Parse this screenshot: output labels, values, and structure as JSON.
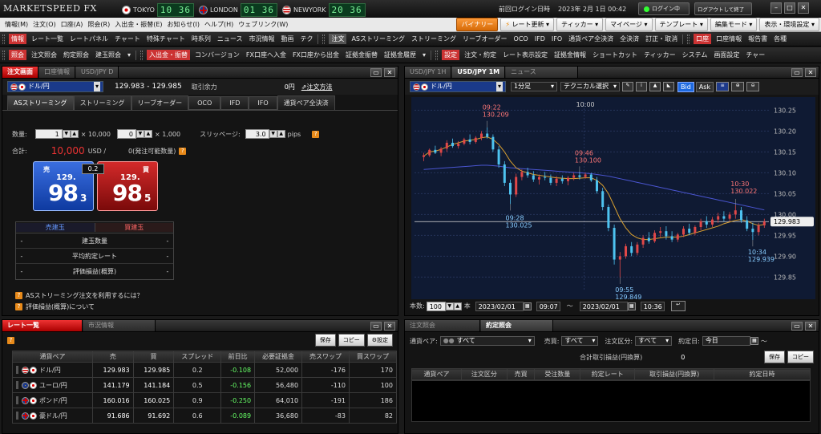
{
  "titlebar": {
    "logo": "MARKETSPEED FX",
    "cities": [
      {
        "name": "TOKYO",
        "time": "10 36",
        "flag": "jp"
      },
      {
        "name": "LONDON",
        "time": "01 36",
        "flag": "uk"
      },
      {
        "name": "NEWYORK",
        "time": "20 36",
        "flag": "us"
      }
    ],
    "last_login_label": "前回ログイン日時",
    "last_login_value": "2023年 2月 1日 00:42",
    "login_status": "ログイン中",
    "logout_btn": "ログアウトして終了"
  },
  "menubar": {
    "items": [
      "情報(M)",
      "注文(O)",
      "口座(A)",
      "照会(R)",
      "入出金・振替(E)",
      "お知らせ(I)",
      "ヘルプ(H)",
      "ウェブリンク(W)"
    ],
    "binary": "バイナリー",
    "rate_update": "レート更新",
    "ticker": "ティッカー",
    "mypage": "マイページ",
    "template": "テンプレート",
    "edit_mode": "編集モード",
    "display_settings": "表示・環境設定"
  },
  "toolbar1": {
    "tag1": "情報",
    "items1": [
      "レート一覧",
      "レートパネル",
      "チャート",
      "特殊チャート",
      "時系列",
      "ニュース",
      "市況情報",
      "動画",
      "テク"
    ],
    "tag2": "注文",
    "items2": [
      "ASストリーミング",
      "ストリーミング",
      "リーブオーダー",
      "OCO",
      "IFD",
      "IFO",
      "通貨ペア全決済",
      "全決済",
      "訂正・取消"
    ],
    "tag3": "口座",
    "items3": [
      "口座情報",
      "報告書",
      "各種"
    ]
  },
  "toolbar2": {
    "tag1": "照会",
    "items1": [
      "注文照会",
      "約定照会",
      "建玉照会"
    ],
    "tag2": "入出金・振替",
    "items2": [
      "コンバージョン",
      "FX口座へ入金",
      "FX口座から出金",
      "証拠金振替",
      "証拠金履歴"
    ],
    "tag3": "設定",
    "items3": [
      "注文・約定",
      "レート表示設定",
      "証拠金情報",
      "ショートカット",
      "ティッカー",
      "システム",
      "画面設定",
      "チャー"
    ]
  },
  "order_panel": {
    "tabs": [
      "注文画面",
      "口座情報",
      "USD/JPY D"
    ],
    "pair": "ドル/円",
    "bid": "129.983",
    "dash": "-",
    "ask": "129.985",
    "margin_label": "取引余力",
    "margin_value": "0円",
    "howto": "注文方法",
    "subtabs": [
      "ASストリーミング",
      "ストリーミング",
      "リーブオーダー",
      "OCO",
      "IFD",
      "IFO",
      "通貨ペア全決済"
    ],
    "qty_label": "数量:",
    "qty1": "1",
    "qty1_unit": "× 10,000",
    "qty2": "0",
    "qty2_unit": "× 1,000",
    "slip_label": "スリッページ:",
    "slip_value": "3.0",
    "slip_unit": "pips",
    "total_label": "合計:",
    "total_value": "10,000",
    "total_unit": "USD /",
    "available": "0(発注可能数量)",
    "sell_label": "売",
    "sell_big": "129.",
    "sell_main": "98",
    "sell_small": "3",
    "spread": "0.2",
    "buy_label": "買",
    "buy_big": "129.",
    "buy_main": "98",
    "buy_small": "5",
    "pos_sell": "売建玉",
    "pos_buy": "買建玉",
    "pos_rows": [
      {
        "label": "建玉数量",
        "left": "-",
        "right": "-"
      },
      {
        "label": "平均約定レート",
        "left": "-",
        "right": "-"
      },
      {
        "label": "評価損益(概算)",
        "left": "-",
        "right": "-"
      }
    ],
    "help1": "ASストリーミング注文を利用するには？",
    "help2": "評価損益(概算)について"
  },
  "chart_panel": {
    "tabs": [
      "USD/JPY 1H",
      "USD/JPY 1M",
      "ニュース"
    ],
    "pair": "ドル/円",
    "period": "1分足",
    "tech": "テクニカル選択",
    "bid_btn": "Bid",
    "ask_btn": "Ask",
    "count_label": "本数:",
    "count_value": "100",
    "count_unit": "本",
    "from_date": "2023/02/01",
    "from_time": "09:07",
    "tilde": "～",
    "to_date": "2023/02/01",
    "to_time": "10:36"
  },
  "chart_data": {
    "type": "candlestick",
    "ylim": [
      129.82,
      130.27
    ],
    "yticks": [
      "130.25",
      "130.20",
      "130.15",
      "130.10",
      "130.05",
      "130.00",
      "129.95",
      "129.90",
      "129.85"
    ],
    "current_price": "129.983",
    "time_marker": "10:00",
    "annotations": [
      {
        "time": "09:22",
        "price": "130.209"
      },
      {
        "time": "09:46",
        "price": "130.100"
      },
      {
        "time": "09:28",
        "price": "130.025"
      },
      {
        "time": "09:55",
        "price": "129.849"
      },
      {
        "time": "10:30",
        "price": "130.022"
      },
      {
        "time": "10:34",
        "price": "129.939"
      }
    ],
    "candles": [
      [
        130.138,
        130.148,
        130.128,
        130.142
      ],
      [
        130.142,
        130.158,
        130.138,
        130.155
      ],
      [
        130.155,
        130.165,
        130.145,
        130.148
      ],
      [
        130.148,
        130.162,
        130.14,
        130.158
      ],
      [
        130.158,
        130.178,
        130.15,
        130.172
      ],
      [
        130.172,
        130.182,
        130.16,
        130.164
      ],
      [
        130.164,
        130.176,
        130.158,
        130.17
      ],
      [
        130.17,
        130.184,
        130.166,
        130.18
      ],
      [
        130.18,
        130.192,
        130.168,
        130.174
      ],
      [
        130.174,
        130.188,
        130.17,
        130.184
      ],
      [
        130.184,
        130.2,
        130.178,
        130.194
      ],
      [
        130.194,
        130.209,
        130.182,
        130.186
      ],
      [
        130.186,
        130.192,
        130.15,
        130.156
      ],
      [
        130.156,
        130.164,
        130.112,
        130.12
      ],
      [
        130.12,
        130.128,
        130.068,
        130.076
      ],
      [
        130.076,
        130.084,
        130.025,
        130.048
      ],
      [
        130.048,
        130.098,
        130.042,
        130.09
      ],
      [
        130.09,
        130.108,
        130.082,
        130.102
      ],
      [
        130.102,
        130.112,
        130.088,
        130.094
      ],
      [
        130.094,
        130.104,
        130.078,
        130.084
      ],
      [
        130.084,
        130.096,
        130.072,
        130.09
      ],
      [
        130.09,
        130.102,
        130.082,
        130.088
      ],
      [
        130.088,
        130.096,
        130.07,
        130.076
      ],
      [
        130.076,
        130.092,
        130.068,
        130.086
      ],
      [
        130.086,
        130.094,
        130.074,
        130.08
      ],
      [
        130.08,
        130.092,
        130.07,
        130.088
      ],
      [
        130.088,
        130.1,
        130.082,
        130.094
      ],
      [
        130.094,
        130.102,
        130.084,
        130.09
      ],
      [
        130.09,
        130.1,
        130.086,
        130.096
      ],
      [
        130.096,
        130.1,
        130.078,
        130.082
      ],
      [
        130.082,
        130.09,
        130.05,
        130.056
      ],
      [
        130.056,
        130.064,
        130.01,
        130.018
      ],
      [
        130.018,
        130.024,
        129.96,
        129.968
      ],
      [
        129.968,
        129.976,
        129.88,
        129.892
      ],
      [
        129.892,
        129.91,
        129.849,
        129.9
      ],
      [
        129.9,
        129.93,
        129.894,
        129.924
      ],
      [
        129.924,
        129.934,
        129.9,
        129.908
      ],
      [
        129.908,
        129.934,
        129.902,
        129.928
      ],
      [
        129.928,
        129.95,
        129.92,
        129.944
      ],
      [
        129.944,
        129.958,
        129.93,
        129.936
      ],
      [
        129.936,
        129.962,
        129.932,
        129.956
      ],
      [
        129.956,
        129.97,
        129.946,
        129.96
      ],
      [
        129.96,
        129.972,
        129.94,
        129.948
      ],
      [
        129.948,
        129.96,
        129.934,
        129.94
      ],
      [
        129.94,
        129.956,
        129.934,
        129.952
      ],
      [
        129.952,
        129.972,
        129.946,
        129.966
      ],
      [
        129.966,
        129.978,
        129.95,
        129.956
      ],
      [
        129.956,
        129.974,
        129.95,
        129.97
      ],
      [
        129.97,
        129.99,
        129.962,
        129.984
      ],
      [
        129.984,
        129.996,
        129.968,
        129.976
      ],
      [
        129.976,
        129.994,
        129.97,
        129.988
      ],
      [
        129.988,
        130.004,
        129.98,
        129.996
      ],
      [
        129.996,
        130.008,
        129.984,
        129.99
      ],
      [
        129.99,
        130.006,
        129.984,
        130.0
      ],
      [
        130.0,
        130.022,
        129.99,
        130.01
      ],
      [
        130.01,
        130.018,
        129.98,
        129.986
      ],
      [
        129.986,
        129.996,
        129.96,
        129.966
      ],
      [
        129.966,
        129.98,
        129.939,
        129.958
      ],
      [
        129.958,
        129.98,
        129.95,
        129.974
      ],
      [
        129.974,
        129.99,
        129.968,
        129.983
      ]
    ],
    "ma_short": [
      130.14,
      130.15,
      130.152,
      130.156,
      130.162,
      130.168,
      130.172,
      130.176,
      130.178,
      130.18,
      130.184,
      130.186,
      130.18,
      130.168,
      130.15,
      130.128,
      130.112,
      130.104,
      130.1,
      130.096,
      130.094,
      130.092,
      130.09,
      130.088,
      130.087,
      130.086,
      130.086,
      130.087,
      130.088,
      130.088,
      130.082,
      130.07,
      130.05,
      130.02,
      129.99,
      129.968,
      129.952,
      129.944,
      129.94,
      129.94,
      129.942,
      129.944,
      129.946,
      129.946,
      129.946,
      129.948,
      129.952,
      129.956,
      129.96,
      129.964,
      129.968,
      129.972,
      129.978,
      129.982,
      129.986,
      129.988,
      129.984,
      129.978,
      129.974,
      129.976
    ],
    "ma_long": [
      130.108,
      130.109,
      130.11,
      130.111,
      130.112,
      130.113,
      130.114,
      130.115,
      130.116,
      130.117,
      130.118,
      130.118,
      130.117,
      130.116,
      130.114,
      130.112,
      130.111,
      130.11,
      130.109,
      130.108,
      130.107,
      130.106,
      130.105,
      130.104,
      130.103,
      130.102,
      130.101,
      130.1,
      130.099,
      130.098,
      130.096,
      130.094,
      130.092,
      130.089,
      130.086,
      130.083,
      130.08,
      130.077,
      130.074,
      130.071,
      130.068,
      130.065,
      130.062,
      130.059,
      130.056,
      130.053,
      130.05,
      130.047,
      130.044,
      130.041,
      130.038,
      130.035,
      130.032,
      130.029,
      130.026,
      130.023,
      130.02,
      130.017,
      130.014,
      130.011
    ]
  },
  "rate_panel": {
    "tabs": [
      "レート一覧",
      "市況情報"
    ],
    "save": "保存",
    "copy": "コピー",
    "settings": "設定",
    "headers": [
      "通貨ペア",
      "売",
      "買",
      "スプレッド",
      "前日比",
      "必要証拠金",
      "売スワップ",
      "買スワップ"
    ],
    "rows": [
      {
        "pair": "ドル/円",
        "flag": "us",
        "bid": "129.983",
        "ask": "129.985",
        "spread": "0.2",
        "change": "-0.108",
        "margin": "52,000",
        "sell_swap": "-176",
        "buy_swap": "170"
      },
      {
        "pair": "ユーロ/円",
        "flag": "eu",
        "bid": "141.179",
        "ask": "141.184",
        "spread": "0.5",
        "change": "-0.156",
        "margin": "56,480",
        "sell_swap": "-110",
        "buy_swap": "100"
      },
      {
        "pair": "ポンド/円",
        "flag": "uk",
        "bid": "160.016",
        "ask": "160.025",
        "spread": "0.9",
        "change": "-0.250",
        "margin": "64,010",
        "sell_swap": "-191",
        "buy_swap": "186"
      },
      {
        "pair": "豪ドル/円",
        "flag": "au",
        "bid": "91.686",
        "ask": "91.692",
        "spread": "0.6",
        "change": "-0.089",
        "margin": "36,680",
        "sell_swap": "-83",
        "buy_swap": "82"
      }
    ]
  },
  "exec_panel": {
    "tabs": [
      "注文照会",
      "約定照会"
    ],
    "pair_label": "通貨ペア:",
    "pair_value": "すべて",
    "side_label": "売買:",
    "side_value": "すべて",
    "type_label": "注文区分:",
    "type_value": "すべて",
    "date_label": "約定日:",
    "date_value": "今日",
    "tilde": "～",
    "pl_label": "合計取引損益(円換算)",
    "pl_value": "0",
    "save": "保存",
    "copy": "コピー",
    "headers": [
      "通貨ペア",
      "注文区分",
      "売買",
      "受注数量",
      "約定レート",
      "取引損益(円換算)",
      "約定日時"
    ]
  }
}
